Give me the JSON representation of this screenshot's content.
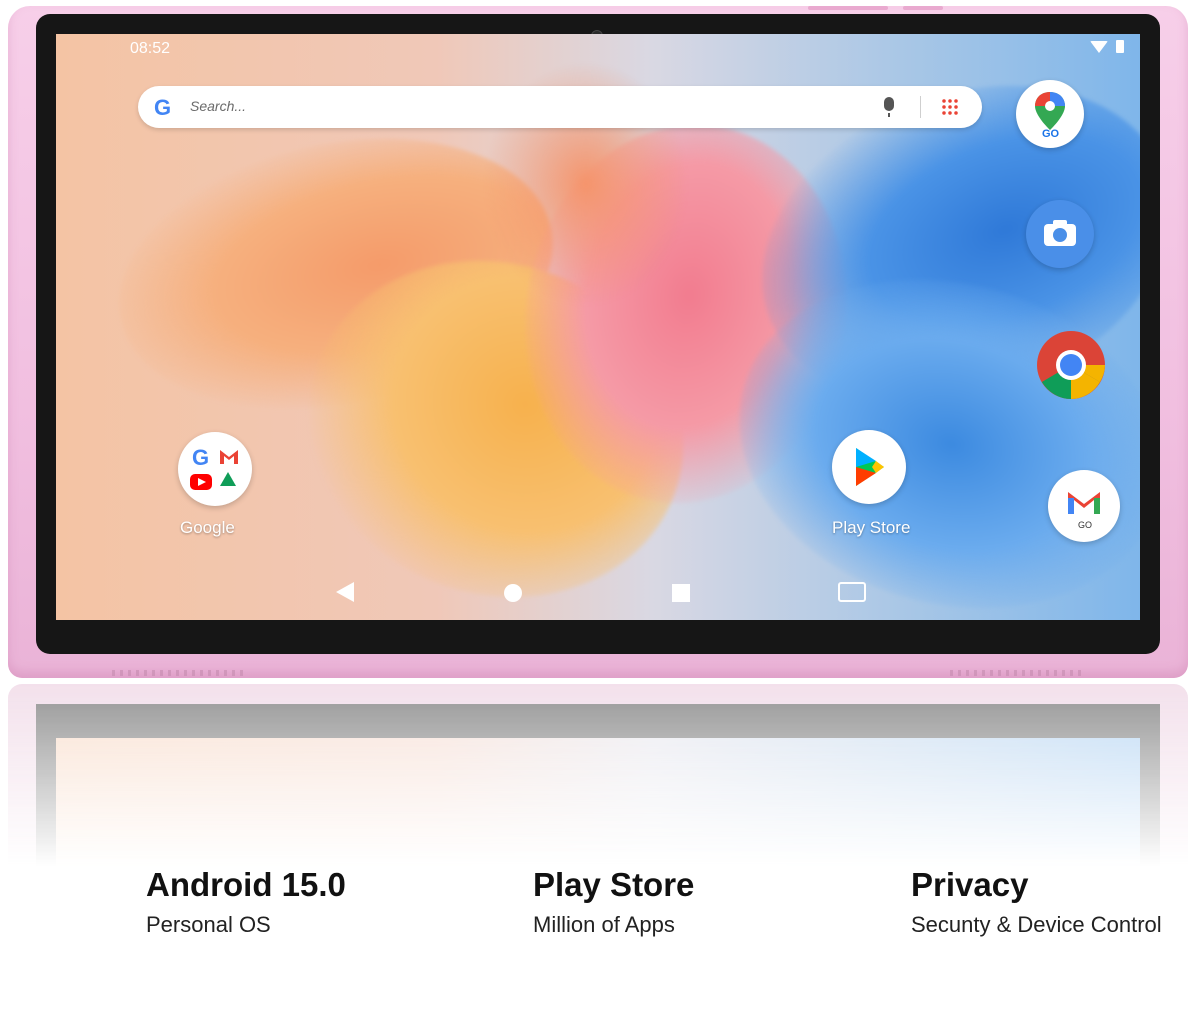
{
  "status_bar": {
    "time": "08:52",
    "icons": [
      "wifi-icon",
      "battery-icon"
    ]
  },
  "search": {
    "placeholder": "Search...",
    "logo": "G",
    "icons": [
      "mic-icon",
      "apps-grid-icon"
    ]
  },
  "home_apps": [
    {
      "name": "Google",
      "icon": "google-folder-icon"
    },
    {
      "name": "Play Store",
      "icon": "play-store-icon"
    }
  ],
  "dock_apps": [
    {
      "icon": "maps-go-icon",
      "badge": "GO"
    },
    {
      "icon": "camera-icon"
    },
    {
      "icon": "chrome-icon"
    },
    {
      "icon": "gmail-go-icon",
      "badge": "GO"
    }
  ],
  "nav_bar": [
    "back-icon",
    "home-icon",
    "recents-icon",
    "screenshot-icon"
  ],
  "features": [
    {
      "title": "Android 15.0",
      "subtitle": "Personal OS"
    },
    {
      "title": "Play Store",
      "subtitle": "Million of Apps"
    },
    {
      "title": "Privacy",
      "subtitle": "Secunty & Device Control"
    }
  ],
  "colors": {
    "tablet_body": "#f1bfe0",
    "bezel": "#161616"
  }
}
